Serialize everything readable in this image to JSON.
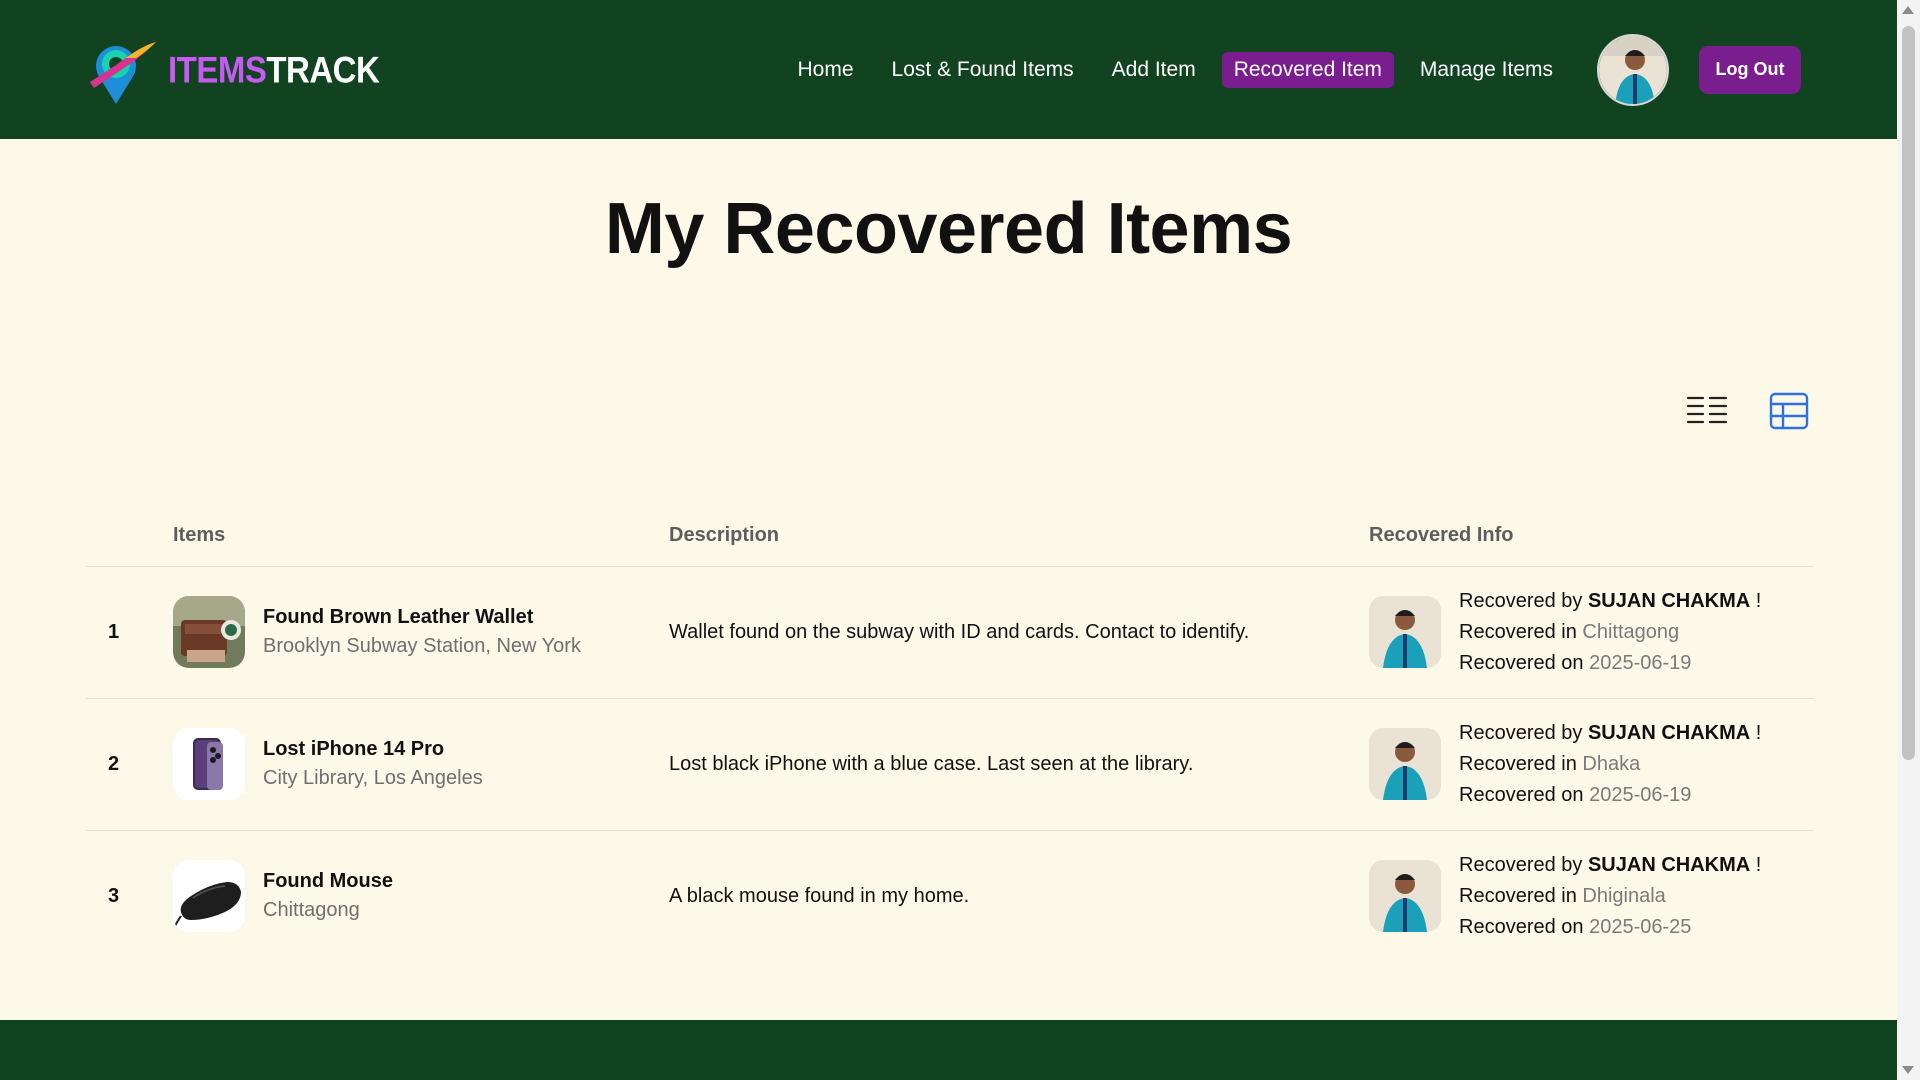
{
  "brand": {
    "part1": "ItemsTrack",
    "first": "ITEMS",
    "second": "TRACK"
  },
  "nav": {
    "links": [
      "Home",
      "Lost & Found Items",
      "Add Item",
      "Recovered Item",
      "Manage Items"
    ],
    "active": "Recovered Item",
    "logout_label": "Log Out"
  },
  "page": {
    "title": "My Recovered Items"
  },
  "view_toggle": {
    "options": [
      "list-view-icon",
      "table-view-icon"
    ],
    "active": "table-view-icon"
  },
  "table": {
    "headers": {
      "items": "Items",
      "description": "Description",
      "recovered_info": "Recovered Info"
    },
    "rows": [
      {
        "index": "1",
        "title": "Found Brown Leather Wallet",
        "location": "Brooklyn Subway Station, New York",
        "description": "Wallet found on the subway with ID and cards. Contact to identify.",
        "recovered_by_label": "Recovered by",
        "recovered_by": "SUJAN CHAKMA",
        "recovered_by_suffix": "!",
        "recovered_in_label": "Recovered in",
        "recovered_in": "Chittagong",
        "recovered_on_label": "Recovered on",
        "recovered_on": "2025-06-19"
      },
      {
        "index": "2",
        "title": "Lost iPhone 14 Pro",
        "location": "City Library, Los Angeles",
        "description": "Lost black iPhone with a blue case. Last seen at the library.",
        "recovered_by_label": "Recovered by",
        "recovered_by": "SUJAN CHAKMA",
        "recovered_by_suffix": "!",
        "recovered_in_label": "Recovered in",
        "recovered_in": "Dhaka",
        "recovered_on_label": "Recovered on",
        "recovered_on": "2025-06-19"
      },
      {
        "index": "3",
        "title": "Found Mouse",
        "location": "Chittagong",
        "description": "A black mouse found in my home.",
        "recovered_by_label": "Recovered by",
        "recovered_by": "SUJAN CHAKMA",
        "recovered_by_suffix": "!",
        "recovered_in_label": "Recovered in",
        "recovered_in": "Dhiginala",
        "recovered_on_label": "Recovered on",
        "recovered_on": "2025-06-25"
      }
    ]
  },
  "colors": {
    "navbar": "#114321",
    "accent": "#7a1d8f",
    "page_bg": "#fdf9e9",
    "toggle_active": "#2f6fe0"
  }
}
